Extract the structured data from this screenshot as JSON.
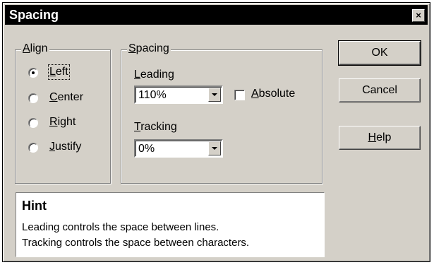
{
  "window": {
    "title": "Spacing",
    "close_glyph": "×"
  },
  "align": {
    "label_pre": "",
    "label_mn": "A",
    "label_post": "lign",
    "options": [
      {
        "pre": "",
        "mn": "L",
        "post": "eft",
        "checked": true
      },
      {
        "pre": "",
        "mn": "C",
        "post": "enter",
        "checked": false
      },
      {
        "pre": "",
        "mn": "R",
        "post": "ight",
        "checked": false
      },
      {
        "pre": "",
        "mn": "J",
        "post": "ustify",
        "checked": false
      }
    ]
  },
  "spacing": {
    "label_pre": "",
    "label_mn": "S",
    "label_post": "pacing",
    "leading": {
      "label_pre": "",
      "label_mn": "L",
      "label_post": "eading",
      "value": "110%"
    },
    "absolute": {
      "label_pre": "",
      "label_mn": "A",
      "label_post": "bsolute",
      "checked": false
    },
    "tracking": {
      "label_pre": "",
      "label_mn": "T",
      "label_post": "racking",
      "value": "0%"
    }
  },
  "buttons": {
    "ok": "OK",
    "cancel": "Cancel",
    "help_pre": "",
    "help_mn": "H",
    "help_post": "elp"
  },
  "hint": {
    "title": "Hint",
    "line1": "Leading controls the space between lines.",
    "line2": "Tracking controls the space between characters."
  }
}
